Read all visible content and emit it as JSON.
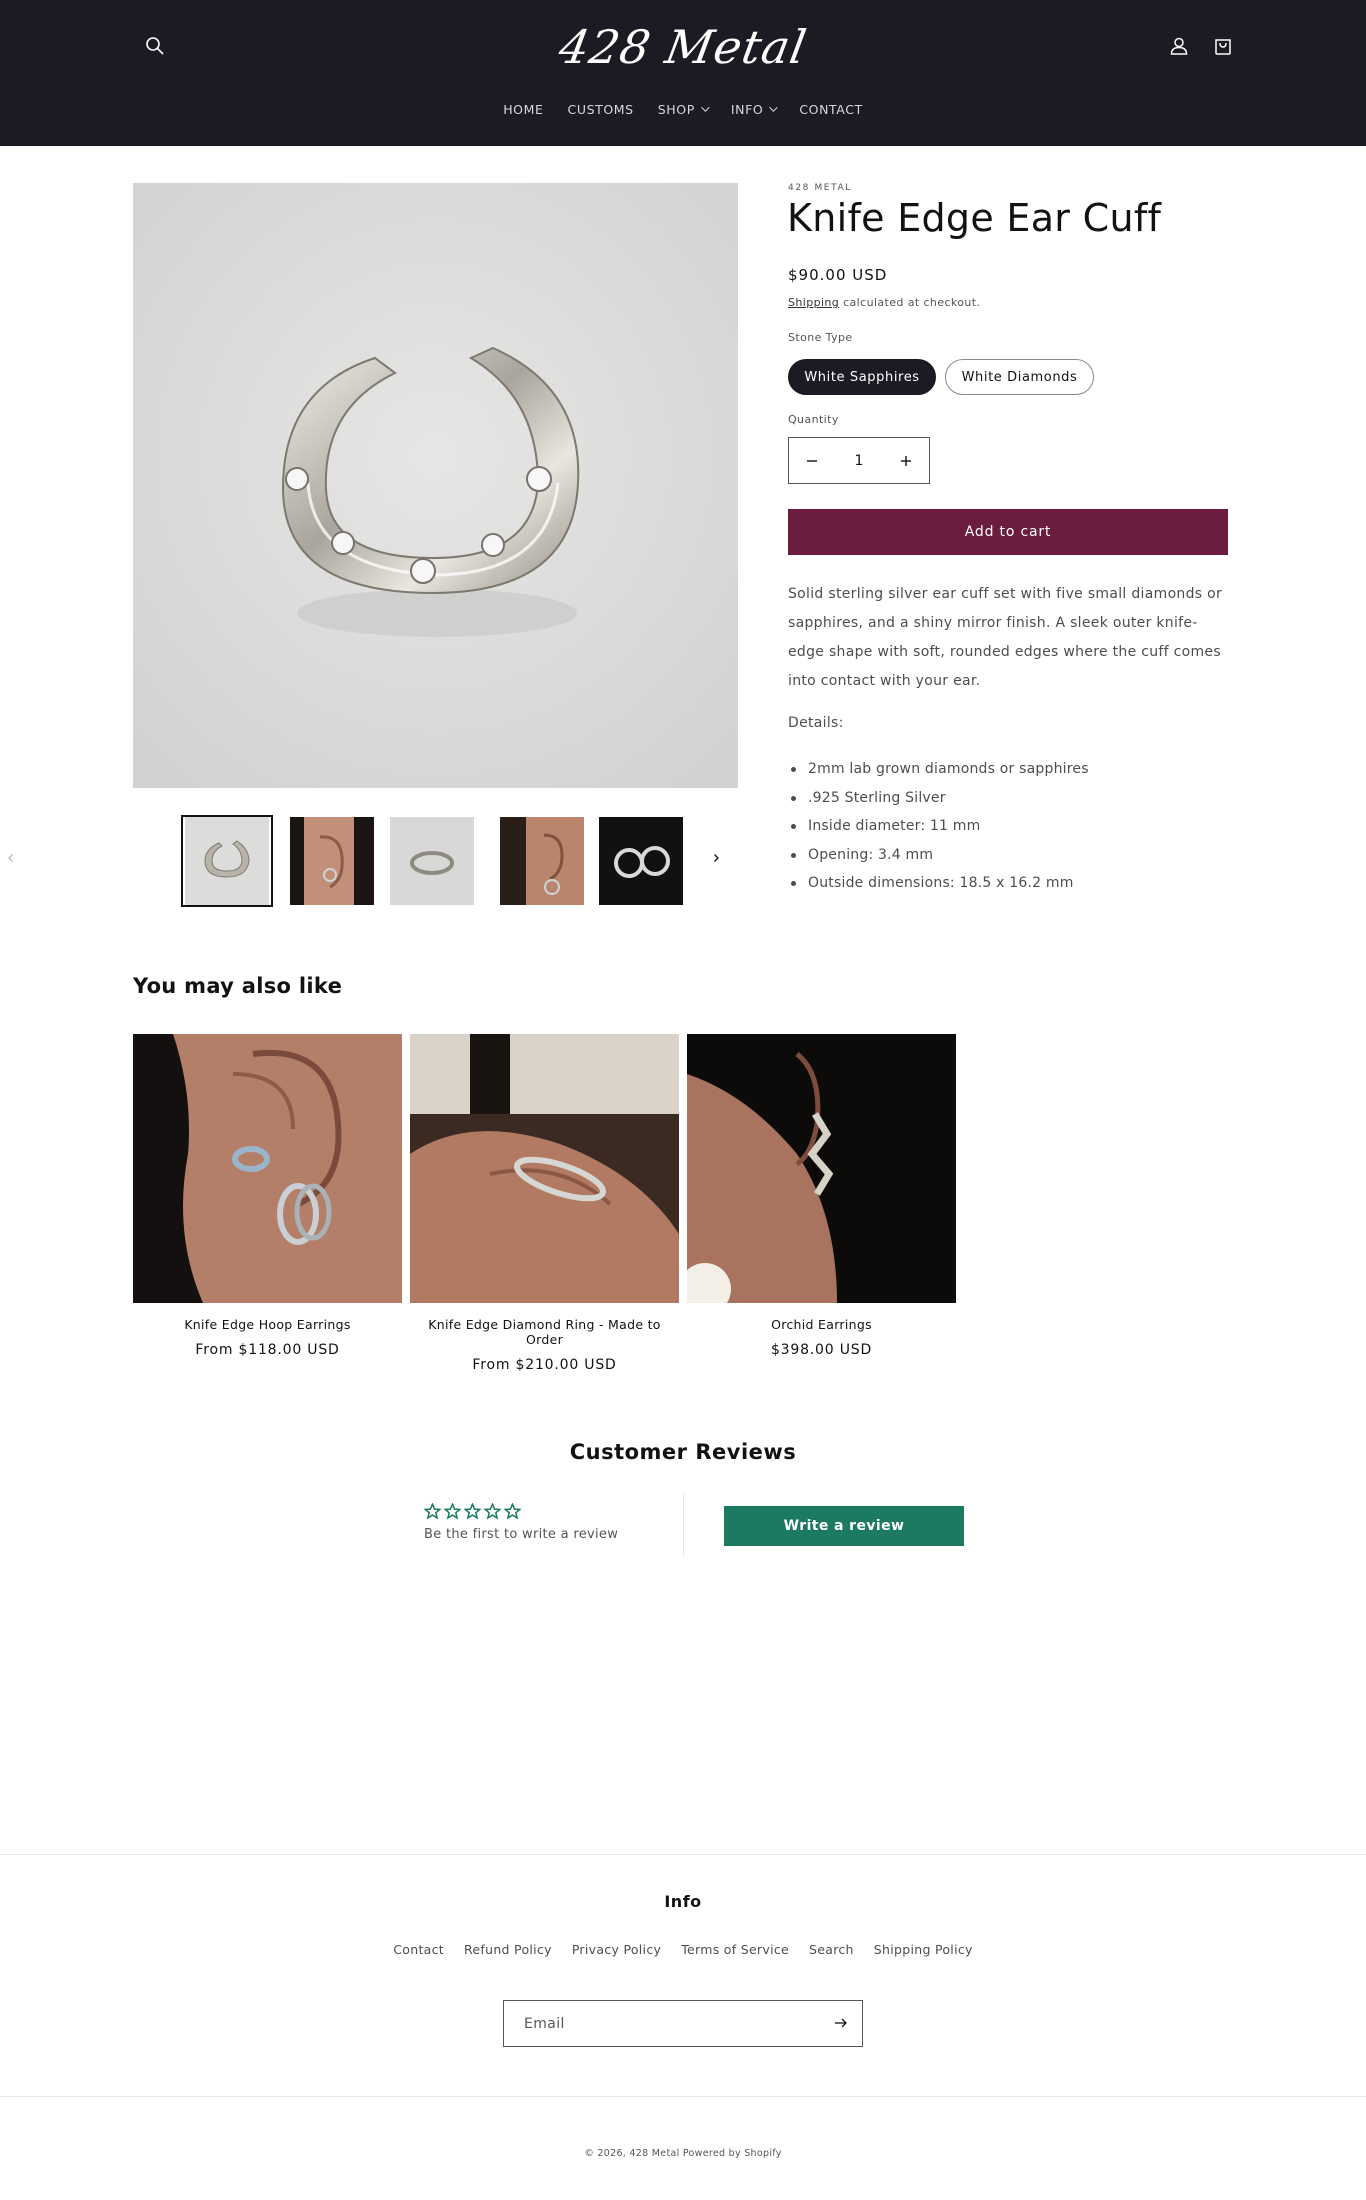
{
  "header": {
    "logo_text": "428 Metal",
    "nav": [
      {
        "label": "HOME",
        "has_dropdown": false
      },
      {
        "label": "CUSTOMS",
        "has_dropdown": false
      },
      {
        "label": "SHOP",
        "has_dropdown": true
      },
      {
        "label": "INFO",
        "has_dropdown": true
      },
      {
        "label": "CONTACT",
        "has_dropdown": false
      }
    ],
    "icons": [
      "search-icon",
      "account-icon",
      "cart-icon"
    ]
  },
  "product": {
    "vendor": "428 METAL",
    "title": "Knife Edge Ear Cuff",
    "price": "$90.00 USD",
    "shipping_link": "Shipping",
    "shipping_note": "calculated at checkout.",
    "option_label": "Stone Type",
    "options": [
      {
        "label": "White Sapphires",
        "selected": true
      },
      {
        "label": "White Diamonds",
        "selected": false
      }
    ],
    "quantity_label": "Quantity",
    "quantity_value": "1",
    "add_to_cart": "Add to cart",
    "description": "Solid sterling silver ear cuff set with five small diamonds or sapphires, and a shiny mirror finish. A sleek outer knife-edge shape with soft, rounded edges where the cuff comes into contact with your ear.",
    "details_heading": "Details:",
    "details": [
      "2mm lab grown diamonds or sapphires",
      ".925 Sterling Silver",
      "Inside diameter: 11 mm",
      "Opening: 3.4 mm",
      "Outside dimensions: 18.5 x 16.2 mm"
    ],
    "thumbnails_count": 5,
    "active_thumbnail": 1
  },
  "recommendations": {
    "title": "You may also like",
    "items": [
      {
        "name": "Knife Edge Hoop Earrings",
        "price": "From $118.00 USD"
      },
      {
        "name": "Knife Edge Diamond Ring - Made to Order",
        "price": "From $210.00 USD"
      },
      {
        "name": "Orchid Earrings",
        "price": "$398.00 USD"
      }
    ]
  },
  "reviews": {
    "title": "Customer Reviews",
    "rating_stars": 0,
    "max_stars": 5,
    "empty_text": "Be the first to write a review",
    "write_button": "Write a review"
  },
  "footer": {
    "heading": "Info",
    "links": [
      "Contact",
      "Refund Policy",
      "Privacy Policy",
      "Terms of Service",
      "Search",
      "Shipping Policy"
    ],
    "email_placeholder": "Email",
    "copyright": "© 2026, 428 Metal Powered by Shopify"
  },
  "colors": {
    "header_bg": "#1b1b24",
    "add_to_cart": "#6c1d3f",
    "review_accent": "#1c7a62"
  }
}
